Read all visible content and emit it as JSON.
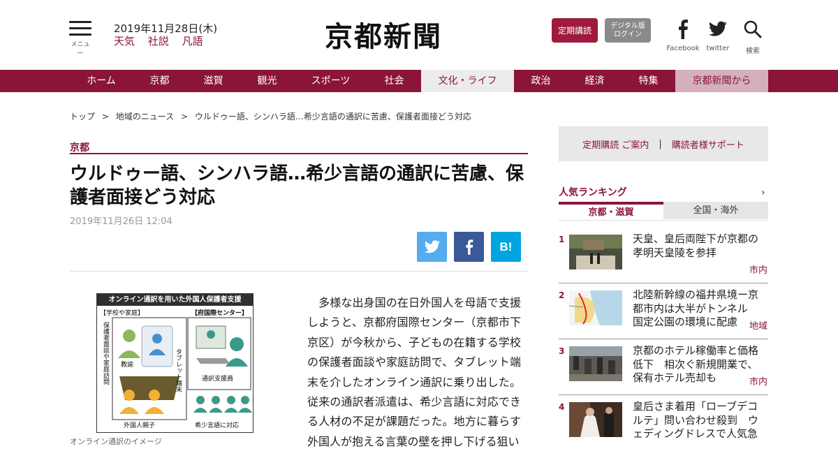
{
  "header": {
    "menu_label": "メニュー",
    "date": "2019年11月28日(木)",
    "quick_links": [
      "天気",
      "社説",
      "凡語"
    ],
    "logo_text": "京都新聞",
    "subscribe_button": "定期講読",
    "digital_button_line1": "デジタル版",
    "digital_button_line2": "ログイン",
    "facebook_label": "Facebook",
    "twitter_label": "twitter",
    "search_label": "検索",
    "icons": {
      "menu": "hamburger-icon",
      "facebook": "facebook-icon",
      "twitter": "twitter-icon",
      "search": "search-icon"
    }
  },
  "nav": {
    "items": [
      "ホーム",
      "京都",
      "滋賀",
      "観光",
      "スポーツ",
      "社会",
      "文化・ライフ",
      "政治",
      "経済",
      "特集",
      "京都新聞から"
    ],
    "active_index": 6,
    "accent": "#8b1538"
  },
  "breadcrumb": [
    "トップ",
    "地域のニュース",
    "ウルドゥー語、シンハラ語…希少言語の通訳に苦慮、保護者面接どう対応"
  ],
  "article": {
    "category": "京都",
    "title": "ウルドゥー語、シンハラ語…希少言語の通訳に苦慮、保護者面接どう対応",
    "published": "2019年11月26日 12:04",
    "share": {
      "twitter": "twitter-icon",
      "facebook": "facebook-icon",
      "hatena": "B!"
    },
    "figure": {
      "title": "オンライン通訳を用いた外国人保護者支援",
      "school_label": "【学校や家庭】",
      "center_label": "【府国際センター】",
      "interview_label": "保護者面談や家庭訪問",
      "tablet_label": "タブレット端末",
      "teacher_label": "教諭",
      "parent_label": "外国人親子",
      "support_label": "通訳支援員",
      "rare_label": "希少言語に対応"
    },
    "caption": "オンライン通訳のイメージ",
    "body": "多様な出身国の在日外国人を母語で支援しようと、京都府国際センター（京都市下京区）が今秋から、子どもの在籍する学校の保護者面談や家庭訪問で、タブレット端末を介したオンライン通訳に乗り出した。従来の通訳者派遣は、希少言語に対応できる人材の不足が課題だった。地方に暮らす外国人が抱える言葉の壁を押し下げる狙い"
  },
  "sidebar": {
    "links": [
      "定期購読 ご案内",
      "購読者様サポート"
    ],
    "separator": "|",
    "ranking_title": "人気ランキング",
    "ranking_arrow": "›",
    "tabs": [
      "京都・滋賀",
      "全国・海外"
    ],
    "ranking": [
      {
        "num": "1",
        "headline": "天皇、皇后両陛下が京都の孝明天皇陵を参拝",
        "tag": "市内"
      },
      {
        "num": "2",
        "headline": "北陸新幹線の福井県境ー京都市内は大半がトンネル　国定公園の環境に配慮",
        "tag": "地域"
      },
      {
        "num": "3",
        "headline": "京都のホテル稼働率と価格低下　相次ぐ新規開業で、保有ホテル売却も",
        "tag": "市内"
      },
      {
        "num": "4",
        "headline": "皇后さま着用「ローブデコルテ」問い合わせ殺到　ウェディングドレスで人気急",
        "tag": ""
      }
    ]
  }
}
